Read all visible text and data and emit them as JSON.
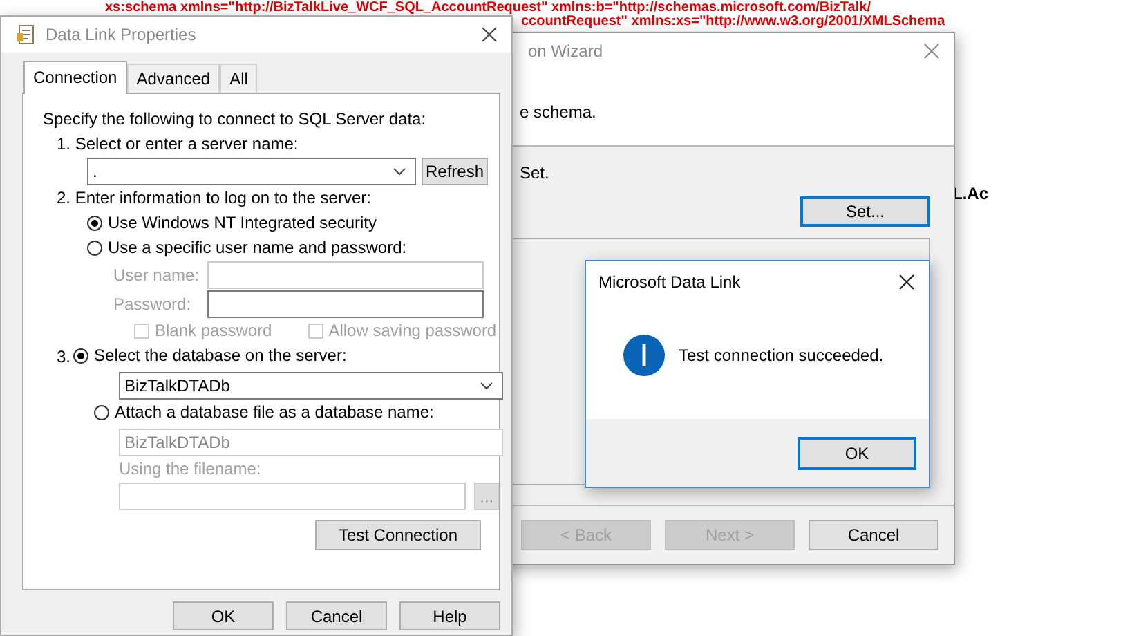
{
  "editor_background": {
    "lines": [
      "xs:schema xmlns=\"http://BizTalkLive_WCF_SQL_AccountRequest\" xmlns:b=\"http://schemas.microsoft.com/BizTalk/",
      "ccountRequest\" xmlns:xs=\"http://www.w3.org/2001/XMLSchema"
    ],
    "fragment": "L.Ac"
  },
  "wizard": {
    "title": "on Wizard",
    "description": "e schema.",
    "instruction": "Set.",
    "set_button": "Set...",
    "buttons": [
      {
        "label": "< Back",
        "disabled": true
      },
      {
        "label": "Next >",
        "disabled": true
      },
      {
        "label": "Cancel",
        "disabled": false
      }
    ]
  },
  "data_link_properties": {
    "title": "Data Link Properties",
    "tabs": [
      {
        "label": "Connection",
        "selected": true
      },
      {
        "label": "Advanced",
        "selected": false
      },
      {
        "label": "All",
        "selected": false
      }
    ],
    "intro": "Specify the following to connect to SQL Server data:",
    "step1_label": "1. Select or enter a server name:",
    "server_name": ".",
    "refresh_button": "Refresh",
    "step2_label": "2. Enter information to log on to the server:",
    "auth_options": [
      {
        "label": "Use Windows NT Integrated security",
        "selected": true
      },
      {
        "label": "Use a specific user name and password:",
        "selected": false
      }
    ],
    "credentials_disabled": true,
    "user_name_label": "User name:",
    "password_label": "Password:",
    "checkboxes": [
      {
        "label": "Blank password",
        "checked": false
      },
      {
        "label": "Allow saving password",
        "checked": false
      }
    ],
    "step3_number": "3.",
    "db_options": [
      {
        "label": "Select the database on the server:",
        "selected": true
      },
      {
        "label": "Attach a database file as a database name:",
        "selected": false
      }
    ],
    "database": "BizTalkDTADb",
    "attach_disabled": true,
    "attach_name": "BizTalkDTADb",
    "filename_label": "Using the filename:",
    "browse_button": "...",
    "test_button": "Test Connection",
    "buttons": [
      "OK",
      "Cancel",
      "Help"
    ]
  },
  "message_box": {
    "title": "Microsoft Data Link",
    "message": "Test connection succeeded.",
    "ok_button": "OK"
  }
}
